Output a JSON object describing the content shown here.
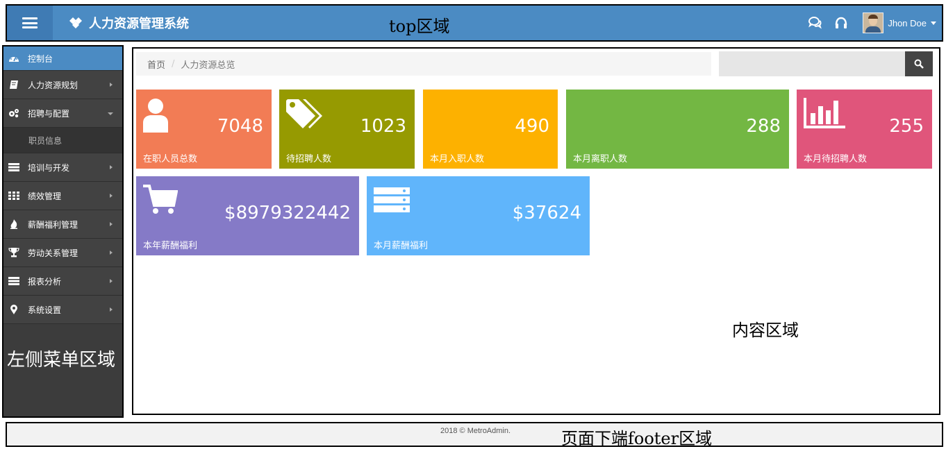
{
  "header": {
    "brand_title": "人力资源管理系统",
    "zone_label": "top区域",
    "user_name": "Jhon Doe"
  },
  "sidebar": {
    "zone_label": "左侧菜单区域",
    "items": [
      {
        "label": "控制台",
        "icon": "dashboard-icon",
        "active": true
      },
      {
        "label": "人力资源规划",
        "icon": "book-icon"
      },
      {
        "label": "招聘与配置",
        "icon": "gears-icon",
        "expanded": true,
        "children": [
          {
            "label": "职员信息"
          }
        ]
      },
      {
        "label": "培训与开发",
        "icon": "server-icon"
      },
      {
        "label": "绩效管理",
        "icon": "grid-icon"
      },
      {
        "label": "薪酬福利管理",
        "icon": "fire-icon"
      },
      {
        "label": "劳动关系管理",
        "icon": "trophy-icon"
      },
      {
        "label": "报表分析",
        "icon": "report-icon"
      },
      {
        "label": "系统设置",
        "icon": "map-marker-icon"
      }
    ]
  },
  "content": {
    "zone_label": "内容区域",
    "breadcrumb": {
      "home": "首页",
      "separator": "/",
      "current": "人力资源总览"
    },
    "search": {
      "placeholder": ""
    },
    "tiles": [
      {
        "value": "7048",
        "label": "在职人员总数",
        "icon": "user-icon",
        "color": "#f27c55"
      },
      {
        "value": "1023",
        "label": "待招聘人数",
        "icon": "tags-icon",
        "color": "#969a01"
      },
      {
        "value": "490",
        "label": "本月入职人数",
        "icon": "none",
        "color": "#fdb100"
      },
      {
        "value": "288",
        "label": "本月离职人数",
        "icon": "none",
        "color": "#73b743"
      },
      {
        "value": "255",
        "label": "本月待招聘人数",
        "icon": "bar-chart-icon",
        "color": "#e0557b"
      },
      {
        "value": "$8979322442",
        "label": "本年薪酬福利",
        "icon": "shopping-cart-icon",
        "color": "#857ac7"
      },
      {
        "value": "$37624",
        "label": "本月薪酬福利",
        "icon": "server-icon",
        "color": "#60b5fb"
      }
    ]
  },
  "footer": {
    "copyright": "2018 © MetroAdmin.",
    "zone_label": "页面下端footer区域"
  }
}
